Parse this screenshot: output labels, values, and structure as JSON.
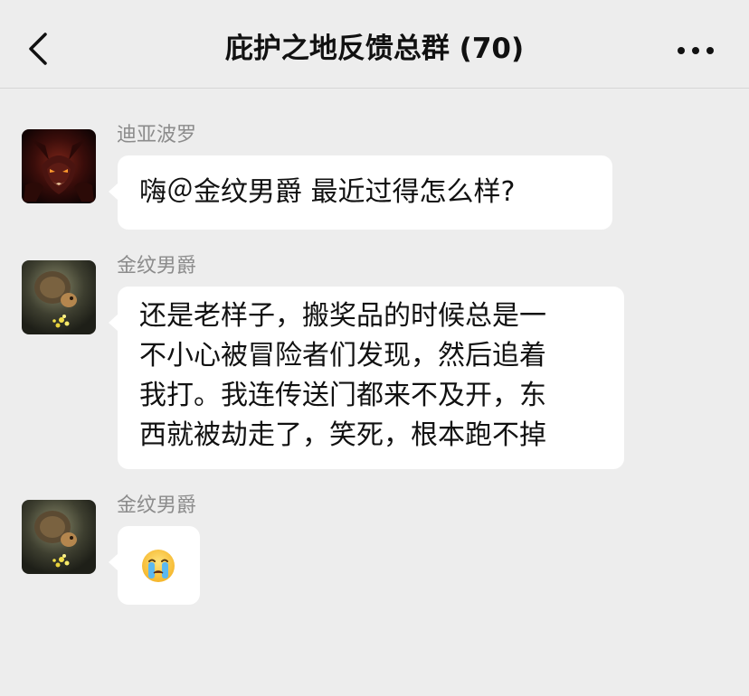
{
  "header": {
    "title": "庇护之地反馈总群 (70)",
    "back_icon": "chevron-left-icon",
    "more_icon": "more-horizontal-icon"
  },
  "messages": [
    {
      "sender": "迪亚波罗",
      "avatar": "demon-avatar",
      "lines": [
        "嗨＠金纹男爵 最近过得怎么样?"
      ]
    },
    {
      "sender": "金纹男爵",
      "avatar": "treasure-goblin-avatar",
      "lines": [
        "还是老样子，搬奖品的时候总是一",
        "不小心被冒险者们发现，然后追着",
        "我打。我连传送门都来不及开，东",
        "西就被劫走了，笑死，根本跑不掉"
      ]
    },
    {
      "sender": "金纹男爵",
      "avatar": "treasure-goblin-avatar",
      "emoji": "crying-face-emoji"
    }
  ],
  "colors": {
    "background": "#ededed",
    "bubble": "#ffffff",
    "sender_text": "#8c8c8c",
    "text": "#111111"
  }
}
